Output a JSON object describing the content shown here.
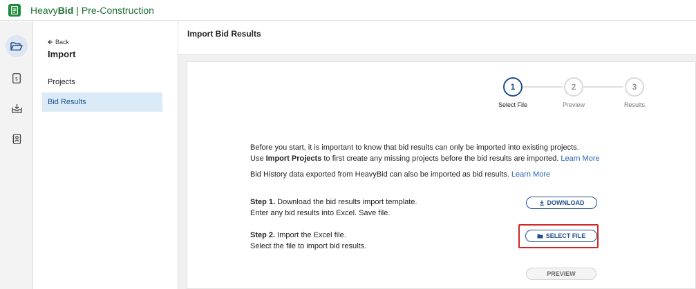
{
  "app": {
    "brand_prefix": "Heavy",
    "brand_bold": "Bid",
    "separator": "|",
    "module": "Pre-Construction"
  },
  "subnav": {
    "back_label": "Back",
    "title": "Import",
    "items": [
      {
        "label": "Projects",
        "active": false
      },
      {
        "label": "Bid Results",
        "active": true
      }
    ]
  },
  "main": {
    "title": "Import Bid Results",
    "stepper": [
      {
        "number": "1",
        "label": "Select File",
        "active": true
      },
      {
        "number": "2",
        "label": "Preview",
        "active": false
      },
      {
        "number": "3",
        "label": "Results",
        "active": false
      }
    ],
    "intro": {
      "line1": "Before you start, it is important to know that bid results can only be imported into existing projects.",
      "line2_prefix": "Use ",
      "line2_bold": "Import Projects",
      "line2_suffix": " to first create any missing projects before the bid results are imported. ",
      "learn_more": "Learn More",
      "line3": "Bid History data exported from HeavyBid can also be imported as bid results. ",
      "learn_more_2": "Learn More"
    },
    "step1": {
      "title": "Step 1.",
      "text": " Download the bid results import template.",
      "line2": "Enter any bid results into Excel. Save file.",
      "button": "DOWNLOAD"
    },
    "step2": {
      "title": "Step 2.",
      "text": " Import the Excel file.",
      "line2": "Select the file to import bid results.",
      "button": "SELECT FILE"
    },
    "preview_button": "PREVIEW"
  },
  "colors": {
    "brand_green": "#1d8c3a",
    "primary_blue": "#1f4f8d",
    "link_blue": "#1f5fae",
    "highlight_red": "#d32424",
    "active_nav_bg": "#dbeaf7"
  },
  "icons": {
    "logo": "heavybid-logo-icon",
    "rail": [
      "folder-open-icon",
      "estimate-document-icon",
      "inbox-download-icon",
      "contacts-book-icon"
    ],
    "back": "arrow-left-icon",
    "download": "download-icon",
    "select_file": "folder-icon"
  }
}
